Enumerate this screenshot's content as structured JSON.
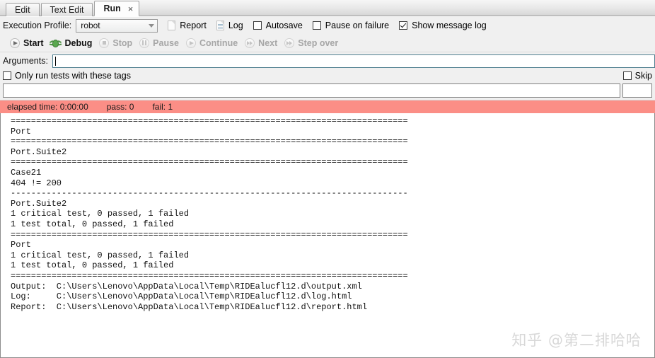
{
  "tabs": [
    {
      "label": "Edit",
      "active": false,
      "closable": false
    },
    {
      "label": "Text Edit",
      "active": false,
      "closable": false
    },
    {
      "label": "Run",
      "active": true,
      "closable": true,
      "close_glyph": "×"
    }
  ],
  "toolbar": {
    "execution_profile_label": "Execution Profile:",
    "execution_profile_value": "robot",
    "report_label": "Report",
    "log_label": "Log",
    "autosave_label": "Autosave",
    "autosave_checked": false,
    "pause_on_failure_label": "Pause on failure",
    "pause_on_failure_checked": false,
    "show_message_log_label": "Show message log",
    "show_message_log_checked": true
  },
  "run_controls": [
    {
      "label": "Start",
      "enabled": true,
      "icon": "play-circle-icon"
    },
    {
      "label": "Debug",
      "enabled": true,
      "icon": "bug-icon"
    },
    {
      "label": "Stop",
      "enabled": false,
      "icon": "stop-circle-icon"
    },
    {
      "label": "Pause",
      "enabled": false,
      "icon": "pause-circle-icon"
    },
    {
      "label": "Continue",
      "enabled": false,
      "icon": "play-circle-icon"
    },
    {
      "label": "Next",
      "enabled": false,
      "icon": "step-forward-icon"
    },
    {
      "label": "Step over",
      "enabled": false,
      "icon": "step-over-icon"
    }
  ],
  "arguments": {
    "label": "Arguments:",
    "value": "",
    "focused": true
  },
  "tags": {
    "only_run_label": "Only run tests with these tags",
    "only_run_checked": false,
    "skip_label": "Skip",
    "skip_checked": false,
    "include_value": "",
    "skip_value": ""
  },
  "status": {
    "elapsed": "elapsed time: 0:00:00",
    "pass": "pass: 0",
    "fail": "fail: 1",
    "background_color": "#fb8e86"
  },
  "console": {
    "text": "==============================================================================\nPort\n==============================================================================\nPort.Suite2\n==============================================================================\nCase21\n404 != 200\n------------------------------------------------------------------------------\nPort.Suite2\n1 critical test, 0 passed, 1 failed\n1 test total, 0 passed, 1 failed\n==============================================================================\nPort\n1 critical test, 0 passed, 1 failed\n1 test total, 0 passed, 1 failed\n==============================================================================\nOutput:  C:\\Users\\Lenovo\\AppData\\Local\\Temp\\RIDEalucfl12.d\\output.xml\nLog:     C:\\Users\\Lenovo\\AppData\\Local\\Temp\\RIDEalucfl12.d\\log.html\nReport:  C:\\Users\\Lenovo\\AppData\\Local\\Temp\\RIDEalucfl12.d\\report.html"
  },
  "watermark": {
    "text": "知乎 @第二排哈哈"
  }
}
